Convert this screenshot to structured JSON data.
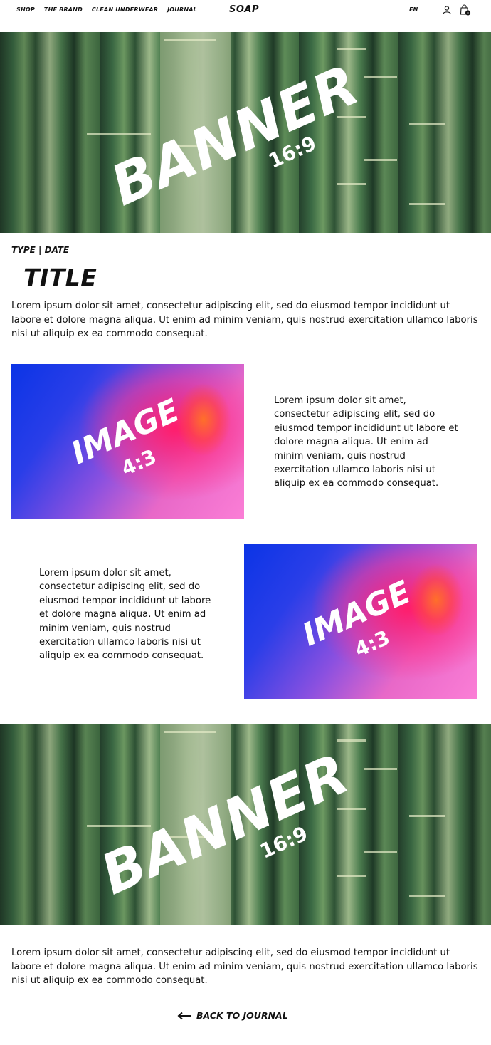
{
  "header": {
    "nav": [
      "SHOP",
      "THE BRAND",
      "CLEAN UNDERWEAR",
      "JOURNAL"
    ],
    "logo": "SOAP",
    "language": "EN",
    "icons": [
      "user-icon",
      "cart-icon"
    ]
  },
  "banner_top": {
    "word": "BANNER",
    "ratio": "16:9"
  },
  "article": {
    "meta": "TYPE  |  DATE",
    "title": "TITLE",
    "intro": "Lorem ipsum dolor sit amet, consectetur adipiscing elit, sed do eiusmod tempor incididunt ut labore et dolore magna aliqua. Ut enim ad minim veniam, quis nostrud exercitation ullamco laboris nisi ut aliquip ex ea commodo consequat.",
    "block1": {
      "image_word": "IMAGE",
      "image_ratio": "4:3",
      "text": "Lorem ipsum dolor sit amet, consectetur adipiscing elit, sed do eiusmod tempor incididunt ut labore et dolore magna aliqua. Ut enim ad minim veniam, quis nostrud exercitation ullamco laboris nisi ut aliquip ex ea commodo consequat."
    },
    "block2": {
      "image_word": "IMAGE",
      "image_ratio": "4:3",
      "text": "Lorem ipsum dolor sit amet, consectetur adipiscing elit, sed do eiusmod tempor incididunt ut labore et dolore magna aliqua. Ut enim ad minim veniam, quis nostrud exercitation ullamco laboris nisi ut aliquip ex ea commodo consequat."
    },
    "outro": "Lorem ipsum dolor sit amet, consectetur adipiscing elit, sed do eiusmod tempor incididunt ut labore et dolore magna aliqua. Ut enim ad minim veniam, quis nostrud exercitation ullamco laboris nisi ut aliquip ex ea commodo consequat."
  },
  "banner_bottom": {
    "word": "BANNER",
    "ratio": "16:9"
  },
  "footer": {
    "back_label": "BACK TO JOURNAL",
    "back_icon": "arrow-left-icon"
  },
  "colors": {
    "text": "#111111",
    "background": "#ffffff",
    "gradient_blue": "#0b34e6",
    "gradient_pink": "#fb7ed6",
    "gradient_red": "#ff1d6b"
  }
}
